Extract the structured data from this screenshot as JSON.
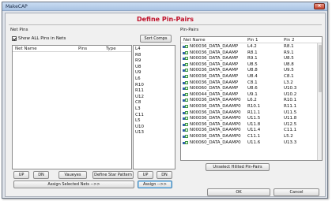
{
  "window": {
    "title": "MakeCAP",
    "close_glyph": "×"
  },
  "dialog": {
    "title": "Define Pin-Pairs"
  },
  "net_pins": {
    "group_label": "Net Pins",
    "sort_button": "Sort Comps",
    "show_all_label": "Show ALL Pins in Nets",
    "columns": [
      "Net Name",
      "Pins",
      "Type"
    ],
    "component_list": [
      "L4",
      "R8",
      "R9",
      "U8",
      "U9",
      "L6",
      "R10",
      "R11",
      "U12",
      "C8",
      "L3",
      "C11",
      "L5",
      "U10",
      "U13"
    ],
    "buttons": {
      "up": "UP",
      "dn": "DN",
      "vaueyes": "Vaueyes",
      "define_star": "Define Star Pattern",
      "up2": "UP",
      "dn2": "DN",
      "assign_selected": "Assign Selected Nets -->>",
      "assign": "Assign -->>"
    }
  },
  "pin_pairs": {
    "group_label": "Pin-Pairs",
    "columns": [
      "Net Name",
      "Pin 1",
      "Pin 2"
    ],
    "rows": [
      {
        "net": "N00036_DATA_DAAMP",
        "pin1": "L4.2",
        "pin2": "R8.1"
      },
      {
        "net": "N00036_DATA_DAAMP",
        "pin1": "R8.1",
        "pin2": "R9.1"
      },
      {
        "net": "N00036_DATA_DAAMP",
        "pin1": "R9.1",
        "pin2": "U8.5"
      },
      {
        "net": "N00036_DATA_DAAMP",
        "pin1": "U8.5",
        "pin2": "U8.8"
      },
      {
        "net": "N00036_DATA_DAAMP",
        "pin1": "U8.8",
        "pin2": "U9.5"
      },
      {
        "net": "N00036_DATA_DAAMP",
        "pin1": "U8.4",
        "pin2": "C8.1"
      },
      {
        "net": "N00036_DATA_DAAMP",
        "pin1": "C8.1",
        "pin2": "L3.2"
      },
      {
        "net": "N00060_DATA_DAAMP",
        "pin1": "U8.6",
        "pin2": "U10.3"
      },
      {
        "net": "N00044_DATA_DAAMP",
        "pin1": "U9.1",
        "pin2": "U10.2"
      },
      {
        "net": "N00036_DATA_DAAMP0",
        "pin1": "L6.2",
        "pin2": "R10.1"
      },
      {
        "net": "N00036_DATA_DAAMP0",
        "pin1": "R10.1",
        "pin2": "R11.1"
      },
      {
        "net": "N00036_DATA_DAAMP0",
        "pin1": "R11.1",
        "pin2": "U11.5"
      },
      {
        "net": "N00036_DATA_DAAMP0",
        "pin1": "U11.5",
        "pin2": "U11.8"
      },
      {
        "net": "N00036_DATA_DAAMP0",
        "pin1": "U11.8",
        "pin2": "U12.5"
      },
      {
        "net": "N00036_DATA_DAAMP0",
        "pin1": "U11.4",
        "pin2": "C11.1"
      },
      {
        "net": "N00036_DATA_DAAMP0",
        "pin1": "C11.1",
        "pin2": "L5.2"
      },
      {
        "net": "N00060_DATA_DAAMP0",
        "pin1": "U11.6",
        "pin2": "U13.3"
      }
    ],
    "unselect_button": "Unselect Hilited Pin-Pairs"
  },
  "footer": {
    "ok": "OK",
    "cancel": "Cancel"
  }
}
